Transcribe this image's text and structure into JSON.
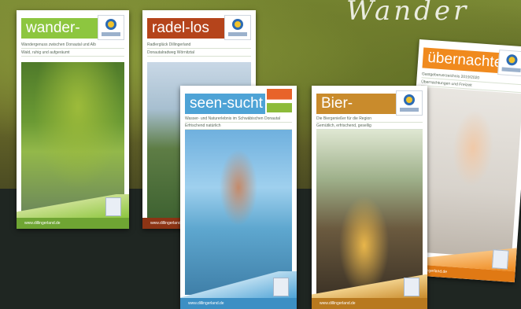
{
  "background": {
    "top_color": "#6f7d2c",
    "bottom_color": "#1f2622"
  },
  "script_title": "Wander",
  "flyers": [
    {
      "title": "wander-bar",
      "accent": "#8dc63f",
      "subtitle": "Wandergenuss zwischen Donautal und Alb",
      "subtitle2": "Wald, ruhig und aufgeräumt",
      "footer": "www.dillingerland.de"
    },
    {
      "title": "radel-los",
      "accent": "#b5441b",
      "subtitle": "Radlerglück Dillingerland",
      "subtitle2": "Donautalradweg Wörnitztal",
      "footer": "www.dillingerland.de"
    },
    {
      "title": "seen-sucht",
      "accent": "#4ea3d6",
      "subtitle": "Wasser- und Naturerlebnis im Schwäbischen Donautal",
      "subtitle2": "Erfrischend natürlich",
      "footer": "www.dillingerland.de"
    },
    {
      "title": "Bier-Kult(o)ur",
      "accent": "#c98b2c",
      "subtitle": "Die Biergenießer für die Region",
      "subtitle2": "Gemütlich, erfrischend, gesellig",
      "footer": "www.dillingerland.de"
    },
    {
      "title": "übernachten",
      "accent": "#f08a1e",
      "subtitle": "Gastgeberverzeichnis 2019/2020",
      "subtitle2": "Übernachtungen und Freizeit",
      "footer": "www.dillingerland.de"
    }
  ]
}
